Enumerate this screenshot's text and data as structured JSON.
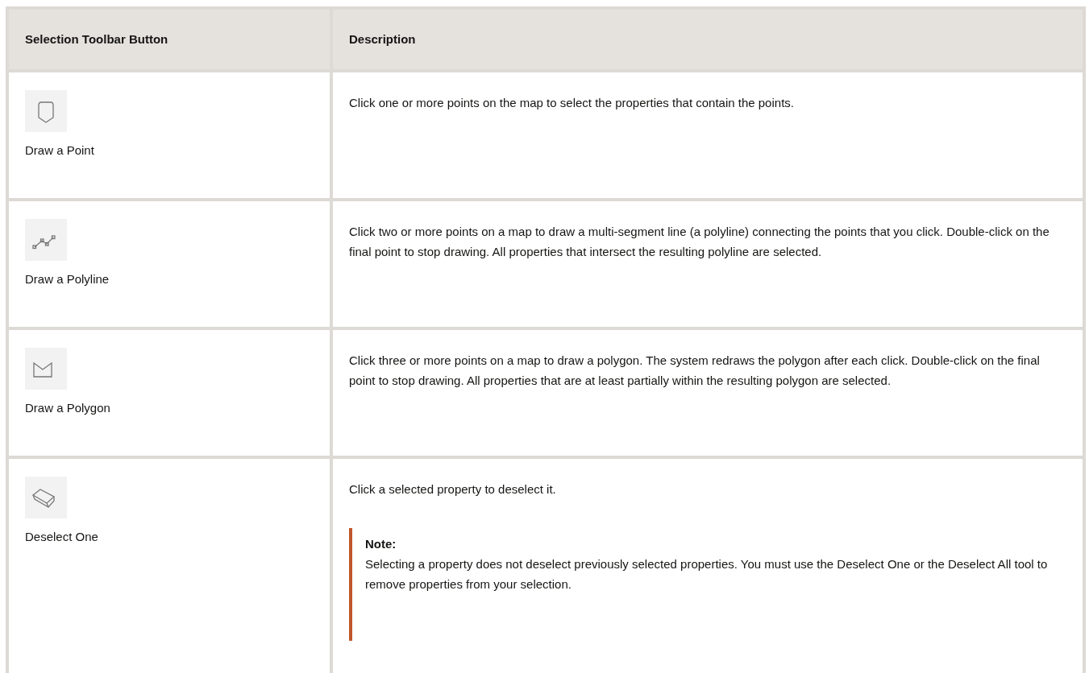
{
  "table": {
    "columns": [
      "Selection Toolbar Button",
      "Description"
    ],
    "rows": [
      {
        "kind": "point",
        "button": "Draw a Point",
        "description": "Click one or more points on the map to select the properties that contain the points."
      },
      {
        "kind": "polyline",
        "button": "Draw a Polyline",
        "description": "Click two or more points on a map to draw a multi-segment line (a polyline) connecting the points that you click. Double-click on the final point to stop drawing. All properties that intersect the resulting polyline are selected."
      },
      {
        "kind": "polygon",
        "button": "Draw a Polygon",
        "description": "Click three or more points on a map to draw a polygon. The system redraws the polygon after each click. Double-click on the final point to stop drawing. All properties that are at least partially within the resulting polygon are selected."
      },
      {
        "kind": "eraser",
        "button": "Deselect One",
        "description": "Click a selected property to deselect it.",
        "note": {
          "title": "Note:",
          "text": "Selecting a property does not deselect previously selected properties. You must use the Deselect One or the Deselect All tool to remove properties from your selection."
        }
      }
    ]
  }
}
